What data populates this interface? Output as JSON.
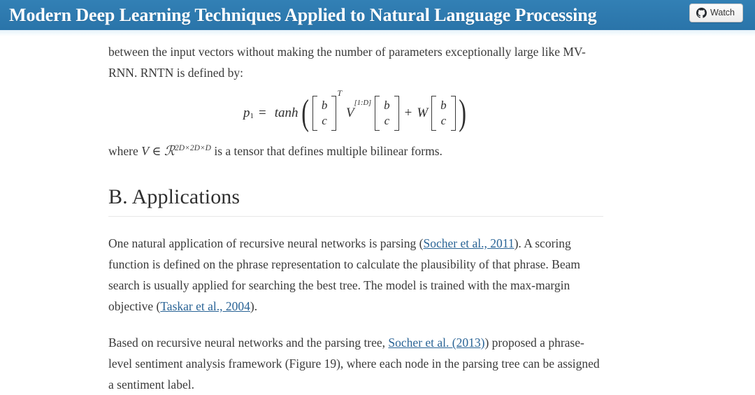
{
  "header": {
    "title": "Modern Deep Learning Techniques Applied to Natural Language Processing",
    "watch_label": "Watch",
    "watch_icon": "github-octocat-icon",
    "background_color": "#2e7ab0",
    "title_color": "#ffffff"
  },
  "content": {
    "paragraph_top": {
      "text": "between the input vectors without making the number of parameters exceptionally large like MV-RNN. RNTN is defined by:"
    },
    "equation": {
      "label": "RNTN equation",
      "latex": "p_1 = tanh\\left(\\begin{bmatrix} b \\\\ c \\end{bmatrix}^T V^{[1:D]} \\begin{bmatrix} b \\\\ c \\end{bmatrix} + W \\begin{bmatrix} b \\\\ c \\end{bmatrix}\\right)",
      "lhs_var": "p",
      "lhs_sub": "1",
      "equals": "=",
      "function": "tanh",
      "vector_top": "b",
      "vector_bottom": "c",
      "transpose": "T",
      "tensor": "V",
      "tensor_sup": "[1:D]",
      "plus": "+",
      "matrix": "W"
    },
    "where_line": {
      "prefix": "where ",
      "var": "V",
      "member": "∈",
      "space": "ℛ",
      "exponent": "2D×2D×D",
      "suffix": " is a tensor that defines multiple bilinear forms."
    },
    "heading": "B. Applications",
    "paragraph_one": {
      "part1": "One natural application of recursive neural networks is parsing (",
      "link1": "Socher et al., 2011",
      "part2": "). A scoring function is defined on the phrase representation to calculate the plausibility of that phrase. Beam search is usually applied for searching the best tree. The model is trained with the max-margin objective (",
      "link2": "Taskar et al., 2004",
      "part3": ")."
    },
    "paragraph_two": {
      "part1": "Based on recursive neural networks and the parsing tree, ",
      "link1": "Socher et al. (2013)",
      "part2": ") proposed a phrase-level sentiment analysis framework (Figure 19), where each node in the parsing tree can be assigned a sentiment label."
    },
    "link_color": "#2a6496",
    "text_color": "#3a3a3a"
  }
}
